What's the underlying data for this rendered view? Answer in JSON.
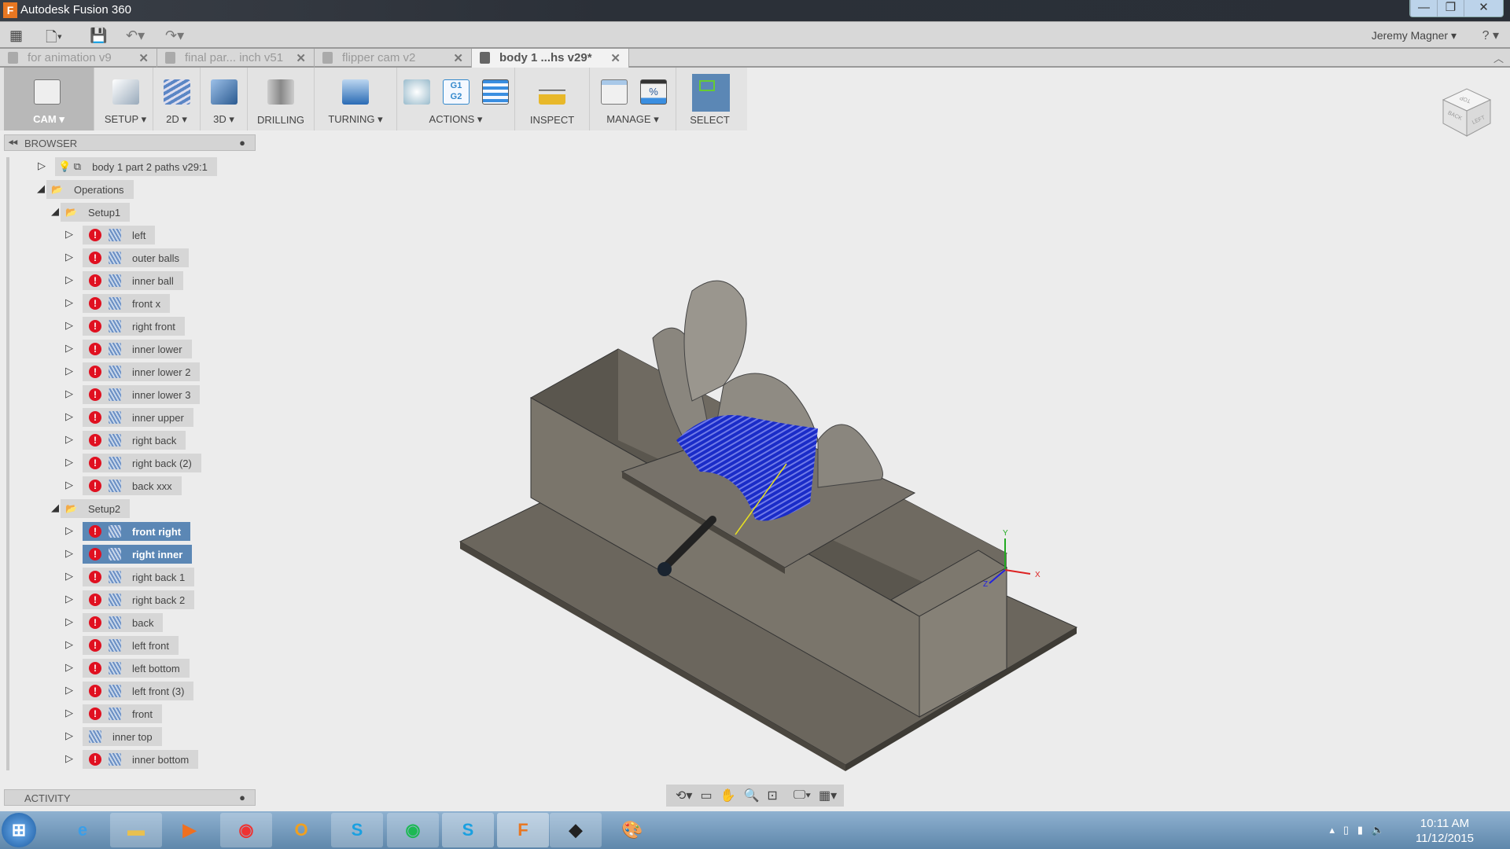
{
  "window": {
    "title": "Autodesk Fusion 360",
    "controls": [
      "—",
      "❐",
      "✕"
    ]
  },
  "qat": {
    "user": "Jeremy Magner ▾",
    "help": "? ▾"
  },
  "tabs": [
    {
      "label": "for animation v9",
      "active": false
    },
    {
      "label": "final par... inch v51",
      "active": false
    },
    {
      "label": "flipper cam v2",
      "active": false
    },
    {
      "label": "body 1 ...hs v29*",
      "active": true
    }
  ],
  "toolbar": {
    "groups": [
      {
        "label": "CAM ▾",
        "color": "#ffffff"
      },
      {
        "label": "SETUP ▾"
      },
      {
        "label": "2D ▾"
      },
      {
        "label": "3D ▾"
      },
      {
        "label": "DRILLING"
      },
      {
        "label": "TURNING ▾"
      },
      {
        "label": "ACTIONS ▾"
      },
      {
        "label": "INSPECT"
      },
      {
        "label": "MANAGE ▾"
      },
      {
        "label": "SELECT"
      }
    ],
    "accent": "#5b87b5"
  },
  "browser": {
    "title": "BROWSER",
    "root": "body 1 part 2 paths v29:1",
    "operations": "Operations",
    "setup1": {
      "label": "Setup1",
      "items": [
        "left",
        "outer balls",
        "inner ball",
        "front x",
        "right front",
        "inner lower",
        "inner lower 2",
        "inner lower 3",
        "inner upper",
        "right back",
        "right back (2)",
        "back xxx"
      ]
    },
    "setup2": {
      "label": "Setup2",
      "items": [
        {
          "label": "front right",
          "error": true,
          "selected": true
        },
        {
          "label": "right inner",
          "error": true,
          "selected": true
        },
        {
          "label": "right back 1",
          "error": true
        },
        {
          "label": "right back 2",
          "error": true
        },
        {
          "label": "back",
          "error": true
        },
        {
          "label": "left front",
          "error": true
        },
        {
          "label": "left bottom",
          "error": true
        },
        {
          "label": "left front (3)",
          "error": true
        },
        {
          "label": "front",
          "error": true
        },
        {
          "label": "inner top",
          "error": false
        },
        {
          "label": "inner bottom",
          "error": true
        }
      ]
    }
  },
  "activity": {
    "title": "ACTIVITY"
  },
  "viewcube": {
    "faces": [
      "TOP",
      "BACK",
      "LEFT"
    ]
  },
  "axes": {
    "x": "X",
    "y": "Y",
    "z": "Z"
  },
  "clock": {
    "time": "10:11 AM",
    "date": "11/12/2015"
  }
}
